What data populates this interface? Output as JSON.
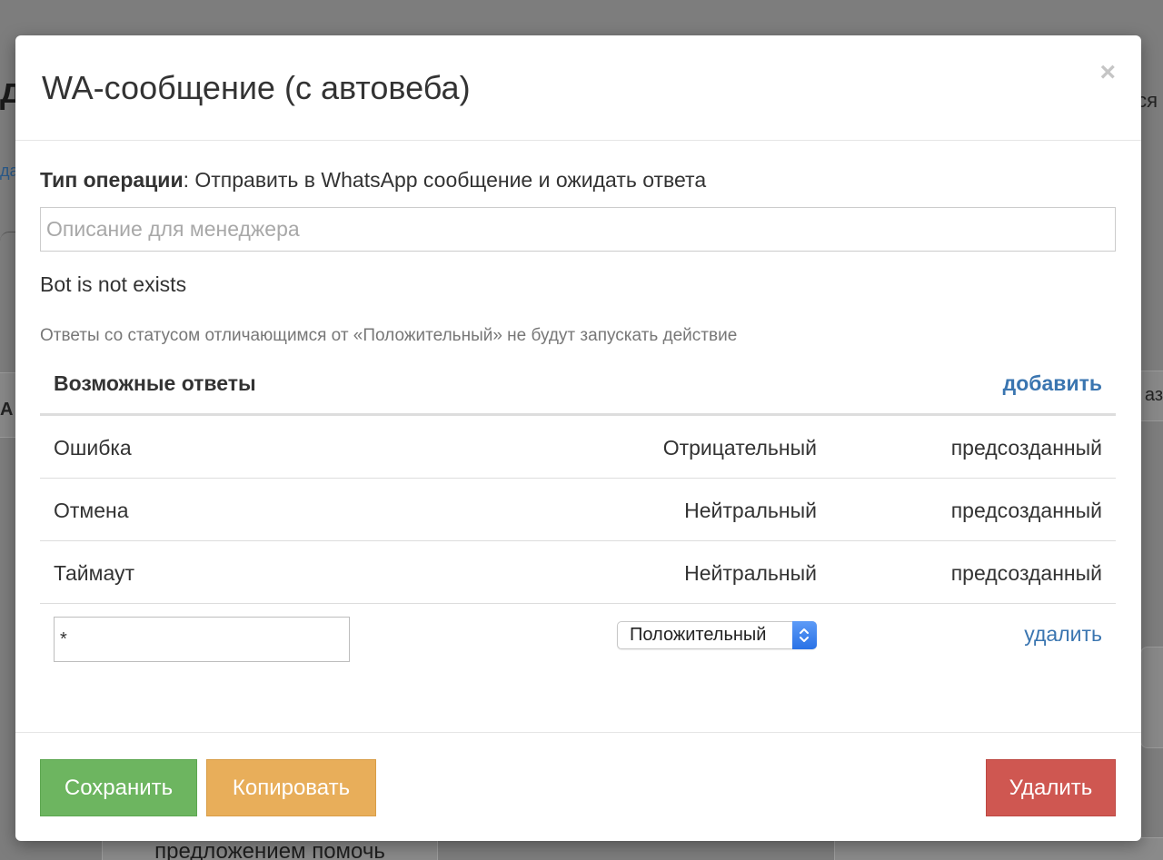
{
  "background": {
    "bottom_text": "предложением помочь"
  },
  "modal": {
    "title": "WA-сообщение (с автовеба)",
    "close_label": "×",
    "operation_type_label": "Тип операции",
    "operation_type_value": ": Отправить в WhatsApp сообщение и ожидать ответа",
    "description_placeholder": "Описание для менеджера",
    "description_value": "",
    "bot_status": "Bot is not exists",
    "hint": "Ответы со статусом отличающимся от «Положительный» не будут запускать действие",
    "answers": {
      "title": "Возможные ответы",
      "add_label": "добавить",
      "rows": [
        {
          "name": "Ошибка",
          "status": "Отрицательный",
          "kind": "предсозданный"
        },
        {
          "name": "Отмена",
          "status": "Нейтральный",
          "kind": "предсозданный"
        },
        {
          "name": "Таймаут",
          "status": "Нейтральный",
          "kind": "предсозданный"
        }
      ],
      "edit_row": {
        "name_value": "*",
        "status_selected": "Положительный",
        "delete_label": "удалить"
      }
    },
    "footer": {
      "save_label": "Сохранить",
      "copy_label": "Копировать",
      "delete_label": "Удалить"
    }
  },
  "colors": {
    "save": "#6db560",
    "copy": "#e8ae5a",
    "delete": "#cf5751",
    "link": "#3a75b0",
    "select_accent": "#2a72e6"
  },
  "icons": {
    "close": "close-icon",
    "select_arrows": "chevron-up-down-icon"
  }
}
